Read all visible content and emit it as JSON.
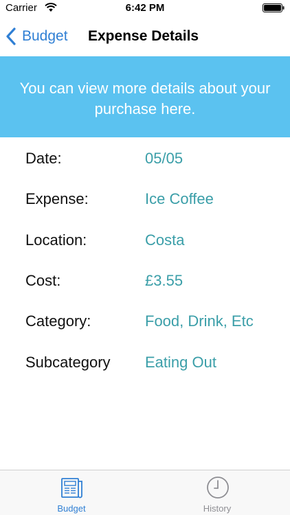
{
  "status_bar": {
    "carrier": "Carrier",
    "time": "6:42 PM"
  },
  "nav": {
    "back_label": "Budget",
    "title": "Expense Details"
  },
  "banner": {
    "text_line1": "You can view more details about your",
    "text_line2": "purchase here."
  },
  "details": [
    {
      "label": "Date:",
      "value": "05/05"
    },
    {
      "label": "Expense:",
      "value": "Ice Coffee"
    },
    {
      "label": "Location:",
      "value": "Costa"
    },
    {
      "label": "Cost:",
      "value": "£3.55"
    },
    {
      "label": "Category:",
      "value": "Food, Drink, Etc"
    },
    {
      "label": "Subcategory",
      "value": "Eating Out"
    }
  ],
  "tab_bar": {
    "items": [
      {
        "label": "Budget",
        "icon": "newspaper-icon",
        "selected": true
      },
      {
        "label": "History",
        "icon": "clock-icon",
        "selected": false
      }
    ]
  },
  "colors": {
    "accent": "#2f7fd4",
    "banner": "#5bc2f0",
    "value_text": "#3a9ea8",
    "inactive_tab": "#8e8e93"
  }
}
